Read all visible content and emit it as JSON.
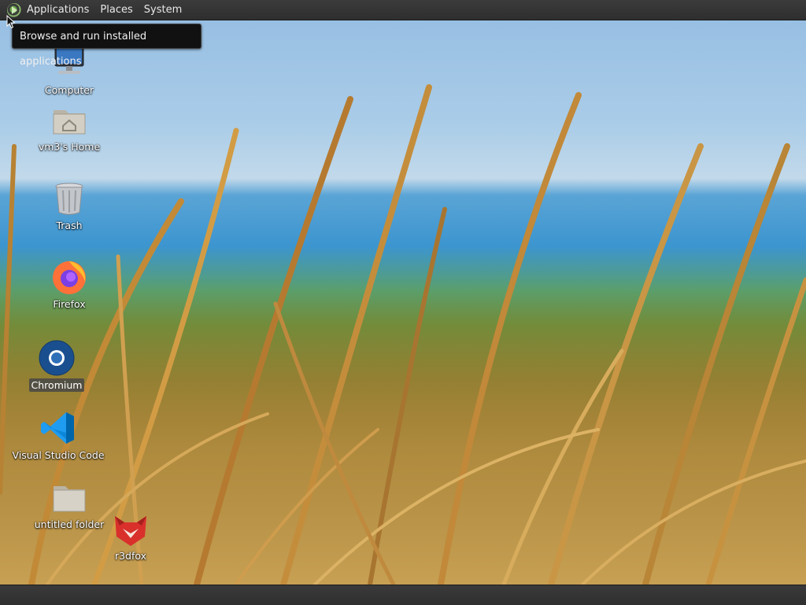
{
  "top_panel": {
    "menus": [
      "Applications",
      "Places",
      "System"
    ]
  },
  "tooltip": {
    "text": "Browse and run installed applications"
  },
  "desktop_icons": [
    {
      "label": "Computer",
      "icon": "computer-icon"
    },
    {
      "label": "vm3's Home",
      "icon": "home-folder-icon"
    },
    {
      "label": "Trash",
      "icon": "trash-icon"
    },
    {
      "label": "Firefox",
      "icon": "firefox-icon"
    },
    {
      "label": "Chromium",
      "icon": "chromium-icon",
      "selected": true
    },
    {
      "label": "Visual Studio Code",
      "icon": "vscode-icon"
    },
    {
      "label": "untitled folder",
      "icon": "folder-icon"
    },
    {
      "label": "r3dfox",
      "icon": "r3dfox-icon"
    }
  ],
  "colors": {
    "panel": "#2e2e2e",
    "tooltip_bg": "#111111",
    "sky": "#a9cce8",
    "sea": "#3c95cf",
    "grass": "#b88d3a"
  }
}
